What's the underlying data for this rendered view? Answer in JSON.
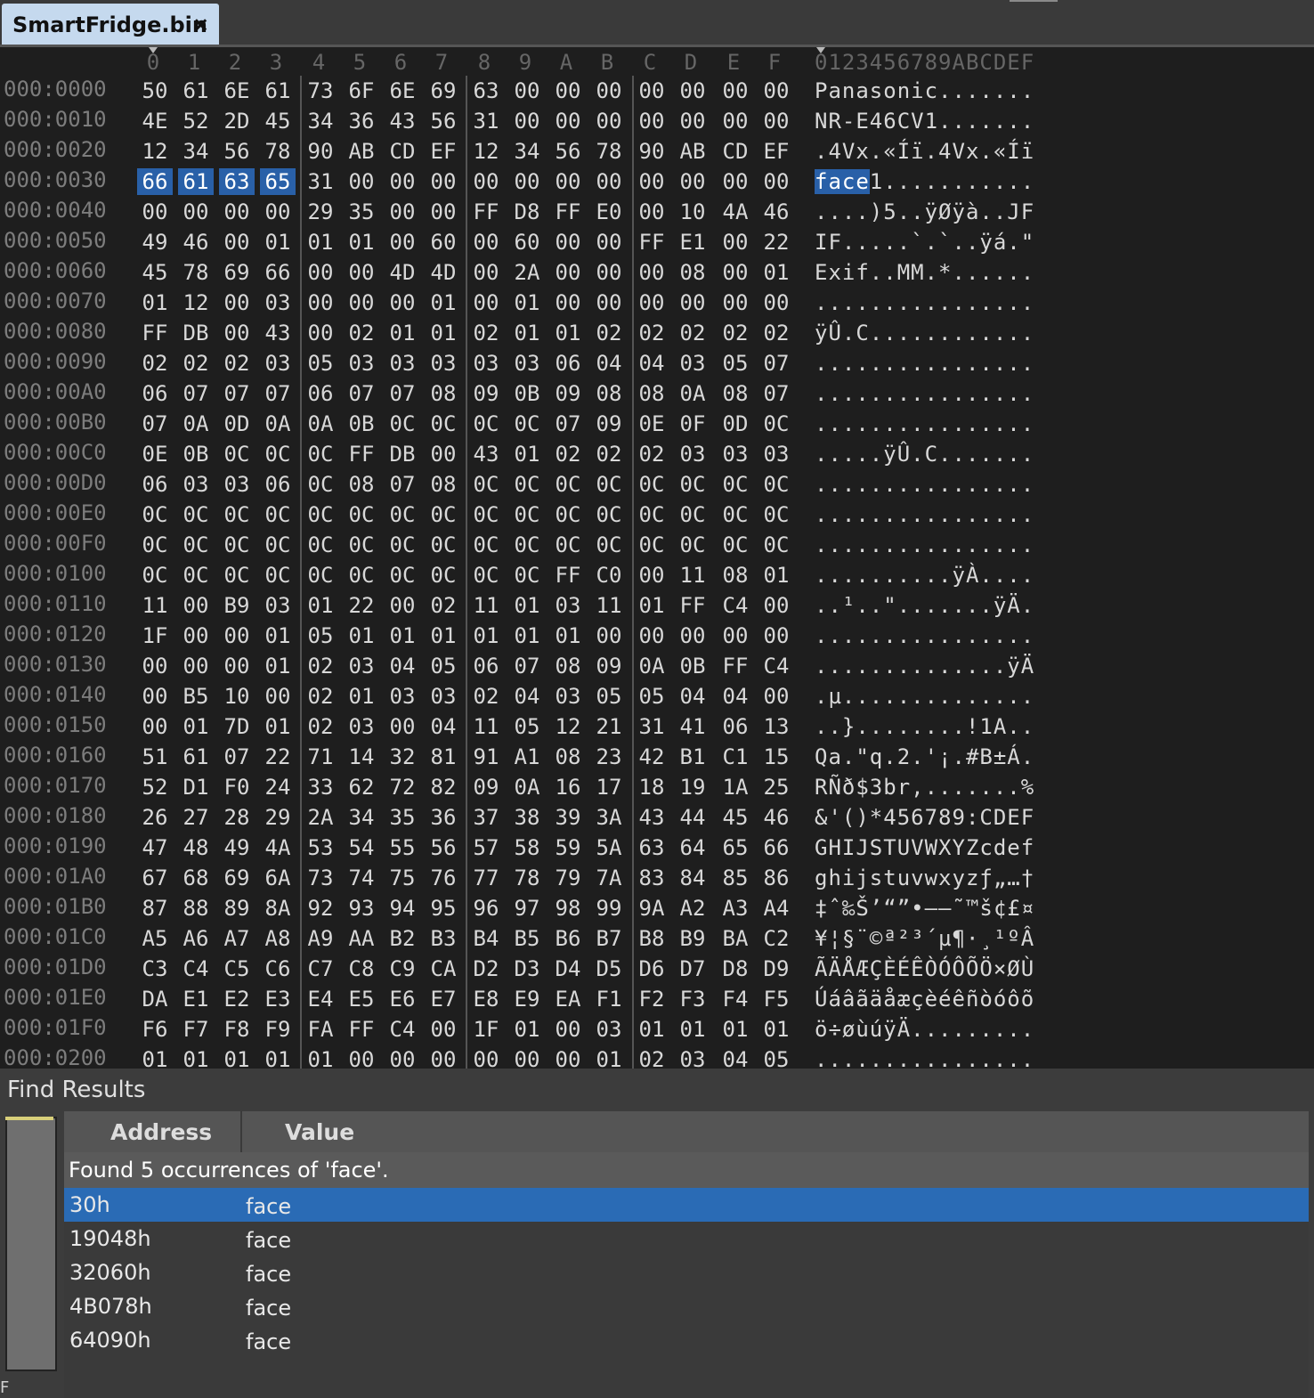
{
  "tab": {
    "title": "SmartFridge.bin"
  },
  "hex_view": {
    "column_headers": [
      "0",
      "1",
      "2",
      "3",
      "4",
      "5",
      "6",
      "7",
      "8",
      "9",
      "A",
      "B",
      "C",
      "D",
      "E",
      "F"
    ],
    "ascii_header": "0123456789ABCDEF",
    "selected_offset": "000:0030",
    "selected_bytes": [
      0,
      1,
      2,
      3
    ],
    "rows": [
      {
        "addr": "000:0000",
        "bytes": [
          "50",
          "61",
          "6E",
          "61",
          "73",
          "6F",
          "6E",
          "69",
          "63",
          "00",
          "00",
          "00",
          "00",
          "00",
          "00",
          "00"
        ],
        "ascii": "Panasonic......."
      },
      {
        "addr": "000:0010",
        "bytes": [
          "4E",
          "52",
          "2D",
          "45",
          "34",
          "36",
          "43",
          "56",
          "31",
          "00",
          "00",
          "00",
          "00",
          "00",
          "00",
          "00"
        ],
        "ascii": "NR-E46CV1......."
      },
      {
        "addr": "000:0020",
        "bytes": [
          "12",
          "34",
          "56",
          "78",
          "90",
          "AB",
          "CD",
          "EF",
          "12",
          "34",
          "56",
          "78",
          "90",
          "AB",
          "CD",
          "EF"
        ],
        "ascii": ".4Vx.«Íï.4Vx.«Íï"
      },
      {
        "addr": "000:0030",
        "bytes": [
          "66",
          "61",
          "63",
          "65",
          "31",
          "00",
          "00",
          "00",
          "00",
          "00",
          "00",
          "00",
          "00",
          "00",
          "00",
          "00"
        ],
        "ascii": "face1..........."
      },
      {
        "addr": "000:0040",
        "bytes": [
          "00",
          "00",
          "00",
          "00",
          "29",
          "35",
          "00",
          "00",
          "FF",
          "D8",
          "FF",
          "E0",
          "00",
          "10",
          "4A",
          "46"
        ],
        "ascii": "....)5..ÿØÿà..JF"
      },
      {
        "addr": "000:0050",
        "bytes": [
          "49",
          "46",
          "00",
          "01",
          "01",
          "01",
          "00",
          "60",
          "00",
          "60",
          "00",
          "00",
          "FF",
          "E1",
          "00",
          "22"
        ],
        "ascii": "IF.....`.`..ÿá.\""
      },
      {
        "addr": "000:0060",
        "bytes": [
          "45",
          "78",
          "69",
          "66",
          "00",
          "00",
          "4D",
          "4D",
          "00",
          "2A",
          "00",
          "00",
          "00",
          "08",
          "00",
          "01"
        ],
        "ascii": "Exif..MM.*......"
      },
      {
        "addr": "000:0070",
        "bytes": [
          "01",
          "12",
          "00",
          "03",
          "00",
          "00",
          "00",
          "01",
          "00",
          "01",
          "00",
          "00",
          "00",
          "00",
          "00",
          "00"
        ],
        "ascii": "................"
      },
      {
        "addr": "000:0080",
        "bytes": [
          "FF",
          "DB",
          "00",
          "43",
          "00",
          "02",
          "01",
          "01",
          "02",
          "01",
          "01",
          "02",
          "02",
          "02",
          "02",
          "02"
        ],
        "ascii": "ÿÛ.C............"
      },
      {
        "addr": "000:0090",
        "bytes": [
          "02",
          "02",
          "02",
          "03",
          "05",
          "03",
          "03",
          "03",
          "03",
          "03",
          "06",
          "04",
          "04",
          "03",
          "05",
          "07"
        ],
        "ascii": "................"
      },
      {
        "addr": "000:00A0",
        "bytes": [
          "06",
          "07",
          "07",
          "07",
          "06",
          "07",
          "07",
          "08",
          "09",
          "0B",
          "09",
          "08",
          "08",
          "0A",
          "08",
          "07"
        ],
        "ascii": "................"
      },
      {
        "addr": "000:00B0",
        "bytes": [
          "07",
          "0A",
          "0D",
          "0A",
          "0A",
          "0B",
          "0C",
          "0C",
          "0C",
          "0C",
          "07",
          "09",
          "0E",
          "0F",
          "0D",
          "0C"
        ],
        "ascii": "................"
      },
      {
        "addr": "000:00C0",
        "bytes": [
          "0E",
          "0B",
          "0C",
          "0C",
          "0C",
          "FF",
          "DB",
          "00",
          "43",
          "01",
          "02",
          "02",
          "02",
          "03",
          "03",
          "03"
        ],
        "ascii": ".....ÿÛ.C......."
      },
      {
        "addr": "000:00D0",
        "bytes": [
          "06",
          "03",
          "03",
          "06",
          "0C",
          "08",
          "07",
          "08",
          "0C",
          "0C",
          "0C",
          "0C",
          "0C",
          "0C",
          "0C",
          "0C"
        ],
        "ascii": "................"
      },
      {
        "addr": "000:00E0",
        "bytes": [
          "0C",
          "0C",
          "0C",
          "0C",
          "0C",
          "0C",
          "0C",
          "0C",
          "0C",
          "0C",
          "0C",
          "0C",
          "0C",
          "0C",
          "0C",
          "0C"
        ],
        "ascii": "................"
      },
      {
        "addr": "000:00F0",
        "bytes": [
          "0C",
          "0C",
          "0C",
          "0C",
          "0C",
          "0C",
          "0C",
          "0C",
          "0C",
          "0C",
          "0C",
          "0C",
          "0C",
          "0C",
          "0C",
          "0C"
        ],
        "ascii": "................"
      },
      {
        "addr": "000:0100",
        "bytes": [
          "0C",
          "0C",
          "0C",
          "0C",
          "0C",
          "0C",
          "0C",
          "0C",
          "0C",
          "0C",
          "FF",
          "C0",
          "00",
          "11",
          "08",
          "01"
        ],
        "ascii": "..........ÿÀ...."
      },
      {
        "addr": "000:0110",
        "bytes": [
          "11",
          "00",
          "B9",
          "03",
          "01",
          "22",
          "00",
          "02",
          "11",
          "01",
          "03",
          "11",
          "01",
          "FF",
          "C4",
          "00"
        ],
        "ascii": "..¹..\".......ÿÄ."
      },
      {
        "addr": "000:0120",
        "bytes": [
          "1F",
          "00",
          "00",
          "01",
          "05",
          "01",
          "01",
          "01",
          "01",
          "01",
          "01",
          "00",
          "00",
          "00",
          "00",
          "00"
        ],
        "ascii": "................"
      },
      {
        "addr": "000:0130",
        "bytes": [
          "00",
          "00",
          "00",
          "01",
          "02",
          "03",
          "04",
          "05",
          "06",
          "07",
          "08",
          "09",
          "0A",
          "0B",
          "FF",
          "C4"
        ],
        "ascii": "..............ÿÄ"
      },
      {
        "addr": "000:0140",
        "bytes": [
          "00",
          "B5",
          "10",
          "00",
          "02",
          "01",
          "03",
          "03",
          "02",
          "04",
          "03",
          "05",
          "05",
          "04",
          "04",
          "00"
        ],
        "ascii": ".µ.............."
      },
      {
        "addr": "000:0150",
        "bytes": [
          "00",
          "01",
          "7D",
          "01",
          "02",
          "03",
          "00",
          "04",
          "11",
          "05",
          "12",
          "21",
          "31",
          "41",
          "06",
          "13"
        ],
        "ascii": "..}........!1A.."
      },
      {
        "addr": "000:0160",
        "bytes": [
          "51",
          "61",
          "07",
          "22",
          "71",
          "14",
          "32",
          "81",
          "91",
          "A1",
          "08",
          "23",
          "42",
          "B1",
          "C1",
          "15"
        ],
        "ascii": "Qa.\"q.2.'¡.#B±Á."
      },
      {
        "addr": "000:0170",
        "bytes": [
          "52",
          "D1",
          "F0",
          "24",
          "33",
          "62",
          "72",
          "82",
          "09",
          "0A",
          "16",
          "17",
          "18",
          "19",
          "1A",
          "25"
        ],
        "ascii": "RÑð$3br,.......%"
      },
      {
        "addr": "000:0180",
        "bytes": [
          "26",
          "27",
          "28",
          "29",
          "2A",
          "34",
          "35",
          "36",
          "37",
          "38",
          "39",
          "3A",
          "43",
          "44",
          "45",
          "46"
        ],
        "ascii": "&'()*456789:CDEF"
      },
      {
        "addr": "000:0190",
        "bytes": [
          "47",
          "48",
          "49",
          "4A",
          "53",
          "54",
          "55",
          "56",
          "57",
          "58",
          "59",
          "5A",
          "63",
          "64",
          "65",
          "66"
        ],
        "ascii": "GHIJSTUVWXYZcdef"
      },
      {
        "addr": "000:01A0",
        "bytes": [
          "67",
          "68",
          "69",
          "6A",
          "73",
          "74",
          "75",
          "76",
          "77",
          "78",
          "79",
          "7A",
          "83",
          "84",
          "85",
          "86"
        ],
        "ascii": "ghijstuvwxyzƒ„…†"
      },
      {
        "addr": "000:01B0",
        "bytes": [
          "87",
          "88",
          "89",
          "8A",
          "92",
          "93",
          "94",
          "95",
          "96",
          "97",
          "98",
          "99",
          "9A",
          "A2",
          "A3",
          "A4"
        ],
        "ascii": "‡ˆ‰Š’“”•–—˜™š¢£¤"
      },
      {
        "addr": "000:01C0",
        "bytes": [
          "A5",
          "A6",
          "A7",
          "A8",
          "A9",
          "AA",
          "B2",
          "B3",
          "B4",
          "B5",
          "B6",
          "B7",
          "B8",
          "B9",
          "BA",
          "C2"
        ],
        "ascii": "¥¦§¨©ª²³´µ¶·¸¹ºÂ"
      },
      {
        "addr": "000:01D0",
        "bytes": [
          "C3",
          "C4",
          "C5",
          "C6",
          "C7",
          "C8",
          "C9",
          "CA",
          "D2",
          "D3",
          "D4",
          "D5",
          "D6",
          "D7",
          "D8",
          "D9"
        ],
        "ascii": "ÃÄÅÆÇÈÉÊÒÓÔÕÖ×ØÙ"
      },
      {
        "addr": "000:01E0",
        "bytes": [
          "DA",
          "E1",
          "E2",
          "E3",
          "E4",
          "E5",
          "E6",
          "E7",
          "E8",
          "E9",
          "EA",
          "F1",
          "F2",
          "F3",
          "F4",
          "F5"
        ],
        "ascii": "Úáâãäåæçèéêñòóôõ"
      },
      {
        "addr": "000:01F0",
        "bytes": [
          "F6",
          "F7",
          "F8",
          "F9",
          "FA",
          "FF",
          "C4",
          "00",
          "1F",
          "01",
          "00",
          "03",
          "01",
          "01",
          "01",
          "01"
        ],
        "ascii": "ö÷øùúÿÄ........."
      },
      {
        "addr": "000:0200",
        "bytes": [
          "01",
          "01",
          "01",
          "01",
          "01",
          "00",
          "00",
          "00",
          "00",
          "00",
          "00",
          "01",
          "02",
          "03",
          "04",
          "05"
        ],
        "ascii": "................"
      }
    ]
  },
  "find_results": {
    "title": "Find Results",
    "columns": {
      "address": "Address",
      "value": "Value"
    },
    "summary": "Found 5 occurrences of 'face'.",
    "items": [
      {
        "address": "30h",
        "value": "face",
        "selected": true
      },
      {
        "address": "19048h",
        "value": "face",
        "selected": false
      },
      {
        "address": "32060h",
        "value": "face",
        "selected": false
      },
      {
        "address": "4B078h",
        "value": "face",
        "selected": false
      },
      {
        "address": "64090h",
        "value": "face",
        "selected": false
      }
    ],
    "side_label": "F"
  },
  "colors": {
    "selection": "#2960a8",
    "result_selection": "#2a6bb5",
    "tab": "#c5d9ee"
  }
}
